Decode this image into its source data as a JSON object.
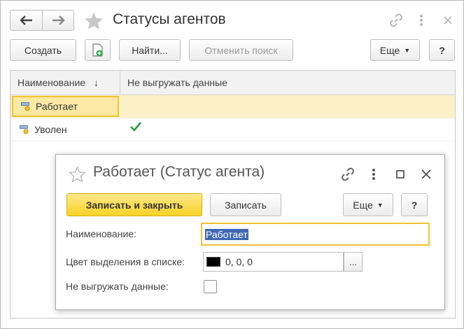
{
  "window": {
    "title": "Статусы агентов",
    "toolbar": {
      "create_label": "Создать",
      "find_label": "Найти...",
      "cancel_search_label": "Отменить поиск",
      "more_label": "Еще",
      "help_label": "?"
    }
  },
  "table": {
    "columns": [
      {
        "label": "Наименование",
        "sort": "descending"
      },
      {
        "label": "Не выгружать данные"
      }
    ],
    "rows": [
      {
        "name": "Работает",
        "no_export": false,
        "selected": true
      },
      {
        "name": "Уволен",
        "no_export": true,
        "selected": false
      }
    ]
  },
  "dialog": {
    "title": "Работает (Статус агента)",
    "save_close_label": "Записать и закрыть",
    "save_label": "Записать",
    "more_label": "Еще",
    "help_label": "?",
    "fields": {
      "name_label": "Наименование:",
      "name_value": "Работает",
      "color_label": "Цвет выделения в списке:",
      "color_value": "0, 0, 0",
      "color_swatch": "#000000",
      "color_button": "...",
      "no_export_label": "Не выгружать данные:",
      "no_export_checked": false
    }
  },
  "colors": {
    "primary_button": "#f7d226",
    "selection": "#fbf0c8",
    "check": "#2a9a3a"
  }
}
